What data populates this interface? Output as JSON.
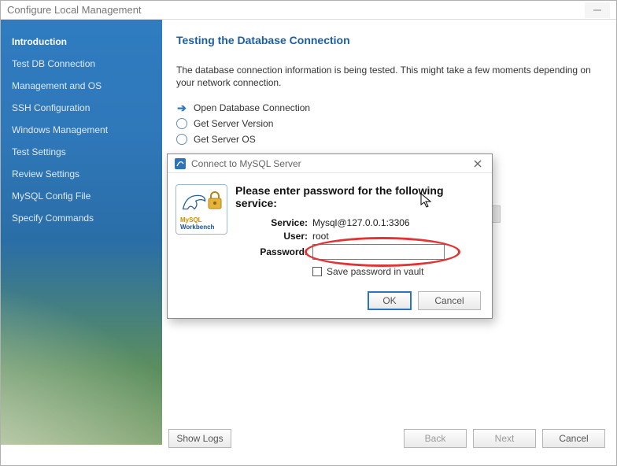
{
  "window": {
    "title": "Configure Local Management"
  },
  "sidebar": {
    "items": [
      {
        "label": "Introduction",
        "active": true
      },
      {
        "label": "Test DB Connection",
        "active": false
      },
      {
        "label": "Management and OS",
        "active": false
      },
      {
        "label": "SSH Configuration",
        "active": false
      },
      {
        "label": "Windows Management",
        "active": false
      },
      {
        "label": "Test Settings",
        "active": false
      },
      {
        "label": "Review Settings",
        "active": false
      },
      {
        "label": "MySQL Config File",
        "active": false
      },
      {
        "label": "Specify Commands",
        "active": false
      }
    ]
  },
  "main": {
    "heading": "Testing the Database Connection",
    "description": "The database connection information is being tested. This might take a few moments depending on your network connection.",
    "steps": [
      {
        "label": "Open Database Connection",
        "state": "current"
      },
      {
        "label": "Get Server Version",
        "state": "pending"
      },
      {
        "label": "Get Server OS",
        "state": "pending"
      }
    ]
  },
  "wizard": {
    "show_logs": "Show Logs",
    "back": "Back",
    "next": "Next",
    "cancel": "Cancel"
  },
  "modal": {
    "title": "Connect to MySQL Server",
    "icon_brand_top": "MySQL",
    "icon_brand_bottom": "Workbench",
    "heading": "Please enter password for the following service:",
    "labels": {
      "service": "Service:",
      "user": "User:",
      "password": "Password:"
    },
    "values": {
      "service": "Mysql@127.0.0.1:3306",
      "user": "root",
      "password": ""
    },
    "save_label": "Save password in vault",
    "save_checked": false,
    "ok": "OK",
    "cancel": "Cancel"
  }
}
